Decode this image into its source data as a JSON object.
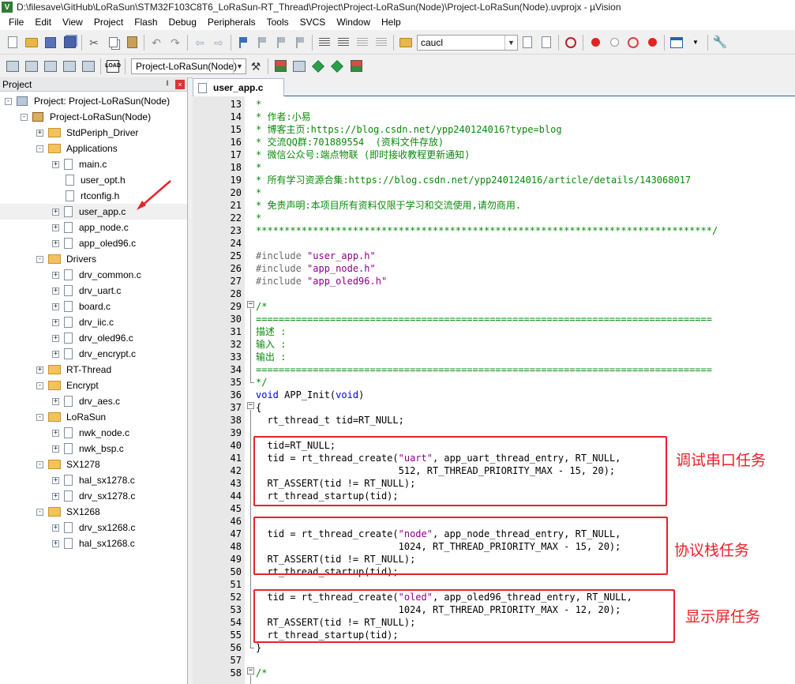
{
  "window": {
    "title": "D:\\filesave\\GitHub\\LoRaSun\\STM32F103C8T6_LoRaSun-RT_Thread\\Project\\Project-LoRaSun(Node)\\Project-LoRaSun(Node).uvprojx - µVision",
    "app_icon": "uvision-icon"
  },
  "menu": [
    "File",
    "Edit",
    "View",
    "Project",
    "Flash",
    "Debug",
    "Peripherals",
    "Tools",
    "SVCS",
    "Window",
    "Help"
  ],
  "toolbar": {
    "find_value": "caucl",
    "target_value": "Project-LoRaSun(Node)"
  },
  "project_panel": {
    "title": "Project",
    "pin_glyph": "⭳",
    "close_glyph": "×",
    "tree": [
      {
        "label": "Project: Project-LoRaSun(Node)",
        "level": 0,
        "kind": "project",
        "toggle": "-"
      },
      {
        "label": "Project-LoRaSun(Node)",
        "level": 1,
        "kind": "target",
        "toggle": "-"
      },
      {
        "label": "StdPeriph_Driver",
        "level": 2,
        "kind": "folder",
        "toggle": "+"
      },
      {
        "label": "Applications",
        "level": 2,
        "kind": "folder",
        "toggle": "-"
      },
      {
        "label": "main.c",
        "level": 3,
        "kind": "file",
        "toggle": "+"
      },
      {
        "label": "user_opt.h",
        "level": 3,
        "kind": "file",
        "toggle": ""
      },
      {
        "label": "rtconfig.h",
        "level": 3,
        "kind": "file",
        "toggle": ""
      },
      {
        "label": "user_app.c",
        "level": 3,
        "kind": "file",
        "toggle": "+",
        "selected": true
      },
      {
        "label": "app_node.c",
        "level": 3,
        "kind": "file",
        "toggle": "+"
      },
      {
        "label": "app_oled96.c",
        "level": 3,
        "kind": "file",
        "toggle": "+"
      },
      {
        "label": "Drivers",
        "level": 2,
        "kind": "folder",
        "toggle": "-"
      },
      {
        "label": "drv_common.c",
        "level": 3,
        "kind": "file",
        "toggle": "+"
      },
      {
        "label": "drv_uart.c",
        "level": 3,
        "kind": "file",
        "toggle": "+"
      },
      {
        "label": "board.c",
        "level": 3,
        "kind": "file",
        "toggle": "+"
      },
      {
        "label": "drv_iic.c",
        "level": 3,
        "kind": "file",
        "toggle": "+"
      },
      {
        "label": "drv_oled96.c",
        "level": 3,
        "kind": "file",
        "toggle": "+"
      },
      {
        "label": "drv_encrypt.c",
        "level": 3,
        "kind": "file",
        "toggle": "+"
      },
      {
        "label": "RT-Thread",
        "level": 2,
        "kind": "folder",
        "toggle": "+"
      },
      {
        "label": "Encrypt",
        "level": 2,
        "kind": "folder",
        "toggle": "-"
      },
      {
        "label": "drv_aes.c",
        "level": 3,
        "kind": "file",
        "toggle": "+"
      },
      {
        "label": "LoRaSun",
        "level": 2,
        "kind": "folder",
        "toggle": "-"
      },
      {
        "label": "nwk_node.c",
        "level": 3,
        "kind": "file",
        "toggle": "+"
      },
      {
        "label": "nwk_bsp.c",
        "level": 3,
        "kind": "file",
        "toggle": "+"
      },
      {
        "label": "SX1278",
        "level": 2,
        "kind": "folder",
        "toggle": "-"
      },
      {
        "label": "hal_sx1278.c",
        "level": 3,
        "kind": "file",
        "toggle": "+"
      },
      {
        "label": "drv_sx1278.c",
        "level": 3,
        "kind": "file",
        "toggle": "+"
      },
      {
        "label": "SX1268",
        "level": 2,
        "kind": "folder",
        "toggle": "-"
      },
      {
        "label": "drv_sx1268.c",
        "level": 3,
        "kind": "file",
        "toggle": "+"
      },
      {
        "label": "hal_sx1268.c",
        "level": 3,
        "kind": "file",
        "toggle": "+"
      }
    ]
  },
  "editor": {
    "tab_label": "user_app.c",
    "lines": [
      {
        "n": "13",
        "parts": [
          {
            "t": "*",
            "c": "cm"
          }
        ]
      },
      {
        "n": "14",
        "parts": [
          {
            "t": "* 作者:小易",
            "c": "cm"
          }
        ]
      },
      {
        "n": "15",
        "parts": [
          {
            "t": "* 博客主页:https://blog.csdn.net/ypp240124016?type=blog",
            "c": "cm"
          }
        ]
      },
      {
        "n": "16",
        "parts": [
          {
            "t": "* 交流QQ群:701889554  (资料文件存放)",
            "c": "cm"
          }
        ]
      },
      {
        "n": "17",
        "parts": [
          {
            "t": "* 微信公众号:端点物联 (即时接收教程更新通知)",
            "c": "cm"
          }
        ]
      },
      {
        "n": "18",
        "parts": [
          {
            "t": "*",
            "c": "cm"
          }
        ]
      },
      {
        "n": "19",
        "parts": [
          {
            "t": "* 所有学习资源合集:https://blog.csdn.net/ypp240124016/article/details/143068017",
            "c": "cm"
          }
        ]
      },
      {
        "n": "20",
        "parts": [
          {
            "t": "*",
            "c": "cm"
          }
        ]
      },
      {
        "n": "21",
        "parts": [
          {
            "t": "* 免责声明:本项目所有资料仅限于学习和交流使用,请勿商用.",
            "c": "cm"
          }
        ]
      },
      {
        "n": "22",
        "parts": [
          {
            "t": "*",
            "c": "cm"
          }
        ]
      },
      {
        "n": "23",
        "parts": [
          {
            "t": "********************************************************************************/",
            "c": "cm"
          }
        ]
      },
      {
        "n": "24",
        "parts": []
      },
      {
        "n": "25",
        "parts": [
          {
            "t": "#include ",
            "c": "pp"
          },
          {
            "t": "\"user_app.h\"",
            "c": "str"
          }
        ]
      },
      {
        "n": "26",
        "parts": [
          {
            "t": "#include ",
            "c": "pp"
          },
          {
            "t": "\"app_node.h\"",
            "c": "str"
          }
        ]
      },
      {
        "n": "27",
        "parts": [
          {
            "t": "#include ",
            "c": "pp"
          },
          {
            "t": "\"app_oled96.h\"",
            "c": "str"
          }
        ]
      },
      {
        "n": "28",
        "parts": []
      },
      {
        "n": "29",
        "parts": [
          {
            "t": "/*",
            "c": "cm"
          }
        ]
      },
      {
        "n": "30",
        "parts": [
          {
            "t": "================================================================================",
            "c": "cm"
          }
        ]
      },
      {
        "n": "31",
        "parts": [
          {
            "t": "描述 :",
            "c": "cm"
          }
        ]
      },
      {
        "n": "32",
        "parts": [
          {
            "t": "输入 :",
            "c": "cm"
          }
        ]
      },
      {
        "n": "33",
        "parts": [
          {
            "t": "输出 :",
            "c": "cm"
          }
        ]
      },
      {
        "n": "34",
        "parts": [
          {
            "t": "================================================================================",
            "c": "cm"
          }
        ]
      },
      {
        "n": "35",
        "parts": [
          {
            "t": "*/",
            "c": "cm"
          }
        ]
      },
      {
        "n": "36",
        "parts": [
          {
            "t": "void",
            "c": "kw"
          },
          {
            "t": " APP_Init(",
            "c": "plain"
          },
          {
            "t": "void",
            "c": "kw"
          },
          {
            "t": ")",
            "c": "plain"
          }
        ]
      },
      {
        "n": "37",
        "parts": [
          {
            "t": "{",
            "c": "plain"
          }
        ]
      },
      {
        "n": "38",
        "parts": [
          {
            "t": "  rt_thread_t tid=RT_NULL;",
            "c": "plain"
          }
        ]
      },
      {
        "n": "39",
        "parts": []
      },
      {
        "n": "40",
        "parts": [
          {
            "t": "  tid=RT_NULL;",
            "c": "plain"
          }
        ]
      },
      {
        "n": "41",
        "parts": [
          {
            "t": "  tid = rt_thread_create(",
            "c": "plain"
          },
          {
            "t": "\"uart\"",
            "c": "str"
          },
          {
            "t": ", app_uart_thread_entry, RT_NULL,",
            "c": "plain"
          }
        ]
      },
      {
        "n": "42",
        "parts": [
          {
            "t": "                         512, RT_THREAD_PRIORITY_MAX - 15, 20);",
            "c": "plain"
          }
        ]
      },
      {
        "n": "43",
        "parts": [
          {
            "t": "  RT_ASSERT(tid != RT_NULL);",
            "c": "plain"
          }
        ]
      },
      {
        "n": "44",
        "parts": [
          {
            "t": "  rt_thread_startup(tid);",
            "c": "plain"
          }
        ]
      },
      {
        "n": "45",
        "parts": []
      },
      {
        "n": "46",
        "parts": []
      },
      {
        "n": "47",
        "parts": [
          {
            "t": "  tid = rt_thread_create(",
            "c": "plain"
          },
          {
            "t": "\"node\"",
            "c": "str"
          },
          {
            "t": ", app_node_thread_entry, RT_NULL,",
            "c": "plain"
          }
        ]
      },
      {
        "n": "48",
        "parts": [
          {
            "t": "                         1024, RT_THREAD_PRIORITY_MAX - 15, 20);",
            "c": "plain"
          }
        ]
      },
      {
        "n": "49",
        "parts": [
          {
            "t": "  RT_ASSERT(tid != RT_NULL);",
            "c": "plain"
          }
        ]
      },
      {
        "n": "50",
        "parts": [
          {
            "t": "  rt_thread_startup(tid);",
            "c": "plain"
          }
        ]
      },
      {
        "n": "51",
        "parts": []
      },
      {
        "n": "52",
        "parts": [
          {
            "t": "  tid = rt_thread_create(",
            "c": "plain"
          },
          {
            "t": "\"oled\"",
            "c": "str"
          },
          {
            "t": ", app_oled96_thread_entry, RT_NULL,",
            "c": "plain"
          }
        ]
      },
      {
        "n": "53",
        "parts": [
          {
            "t": "                         1024, RT_THREAD_PRIORITY_MAX - 12, 20);",
            "c": "plain"
          }
        ]
      },
      {
        "n": "54",
        "parts": [
          {
            "t": "  RT_ASSERT(tid != RT_NULL);",
            "c": "plain"
          }
        ]
      },
      {
        "n": "55",
        "parts": [
          {
            "t": "  rt_thread_startup(tid);",
            "c": "plain"
          }
        ]
      },
      {
        "n": "56",
        "parts": [
          {
            "t": "}",
            "c": "plain"
          }
        ]
      },
      {
        "n": "57",
        "parts": []
      },
      {
        "n": "58",
        "parts": [
          {
            "t": "/*",
            "c": "cm"
          }
        ]
      }
    ]
  },
  "annotations": {
    "uart_task": "调试串口任务",
    "node_task": "协议栈任务",
    "oled_task": "显示屏任务",
    "color": "#e8222a"
  },
  "colors": {
    "comment": "#0a8a0a",
    "keyword": "#0000ff",
    "string": "#8b008b",
    "preprocessor": "#6a6a6a"
  }
}
